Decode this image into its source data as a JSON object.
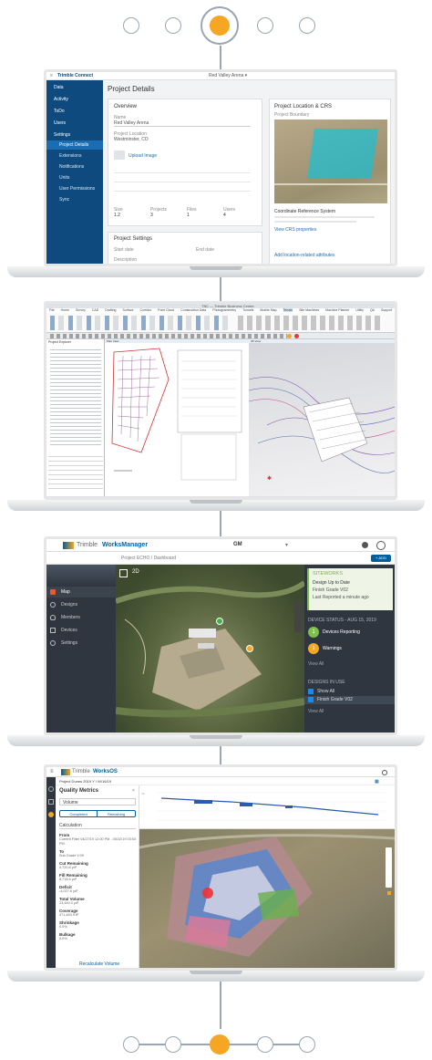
{
  "screens": {
    "connect": {
      "brand": "Trimble Connect",
      "project_selector": "Red Valley Arena ▾",
      "page_title": "Project Details",
      "nav": [
        "Data",
        "Activity",
        "ToDo",
        "Users",
        "Settings",
        "Project Details",
        "Extensions",
        "Notifications",
        "Units",
        "User Permissions",
        "Sync"
      ],
      "overview": {
        "title": "Overview",
        "name_label": "Name",
        "name_value": "Red Valley Arena",
        "location_label": "Project Location",
        "location_value": "Westminster, CO",
        "upload_label": "Upload Image",
        "stats": [
          {
            "label": "Size",
            "value": "1.2"
          },
          {
            "label": "Projects",
            "value": "3"
          },
          {
            "label": "Files",
            "value": "1"
          },
          {
            "label": "Users",
            "value": "4"
          }
        ]
      },
      "location_card": {
        "title": "Project Location & CRS",
        "map_label": "Project Boundary",
        "crs_title": "Coordinate Reference System",
        "link": "View CRS properties"
      },
      "settings_card": {
        "title": "Project Settings",
        "start_label": "Start date",
        "end_label": "End date",
        "desc_label": "Description"
      },
      "footer_link": "Add location-related attributes"
    },
    "business_center": {
      "title": "TBC — Trimble Business Center",
      "menu": [
        "File",
        "Home",
        "Survey",
        "CAD",
        "Drafting",
        "Surface",
        "Corridor",
        "Point Cloud",
        "Construction Data",
        "Photogrammetry",
        "Tunnels",
        "Mobile Map",
        "Terrain",
        "Site Machines",
        "Machine Planner",
        "Utility",
        "QA",
        "Support"
      ],
      "tabs": [
        "Plan View",
        "3D View"
      ],
      "left_panel_title": "Project Explorer",
      "status": "Mon 08/08/2024  1:27 PM"
    },
    "works_manager": {
      "brand_prefix": "Trimble",
      "brand_name": "WorksManager",
      "org": "GM",
      "breadcrumb": "Project ECHO / Dashboard",
      "add_button": "+ ADD",
      "nav": [
        "Map",
        "Designs",
        "Members",
        "Devices",
        "Settings"
      ],
      "zoom_label": "2D",
      "callout": {
        "title": "SITEWORKS",
        "line1": "Design Up to Date",
        "line2": "Finish Grade V02",
        "line3": "Last Reported a minute ago"
      },
      "device_status": {
        "title": "DEVICE STATUS - AUG 15, 2019",
        "reporting_count": "1",
        "reporting_label": "Devices Reporting",
        "warning_count": "1",
        "warning_label": "Warnings",
        "view_all": "View All"
      },
      "designs": {
        "title": "DESIGNS IN USE",
        "show_all": "Show All",
        "item": "Finish Grade V02",
        "view_all": "View All"
      }
    },
    "works_os": {
      "brand_prefix": "Trimble",
      "brand_name": "WorksOS",
      "breadcrumb": "Project Dunes 2019 Y / W/16/19",
      "panel_title": "Quality Metrics",
      "select_value": "Volume",
      "tabs": [
        "Completed",
        "Remaining"
      ],
      "calc_label": "Calculation",
      "metrics": [
        {
          "label": "From",
          "value": "Current Filter 04/27/19 12:00 PM - 05/22/19 03:53 PM"
        },
        {
          "label": "To",
          "value": "Sub Grade V.09"
        },
        {
          "label": "Cut Remaining",
          "value": "4,720.8 yd³"
        },
        {
          "label": "Fill Remaining",
          "value": "8,718.5 yd³"
        },
        {
          "label": "Deficit",
          "value": "-4,027.6 yd³"
        },
        {
          "label": "Total Volume",
          "value": "13,449.3 yd³"
        },
        {
          "label": "Coverage",
          "value": "471,463.9 ft²"
        },
        {
          "label": "Shrinkage",
          "value": "0.0%"
        },
        {
          "label": "Bulkage",
          "value": "0.0%"
        }
      ],
      "recalc": "Recalculate Volume"
    }
  },
  "colors": {
    "accent": "#f5a623",
    "connect_nav": "#0e4a7e",
    "works_blue": "#005f9e",
    "wm_nav": "#2f3640"
  }
}
